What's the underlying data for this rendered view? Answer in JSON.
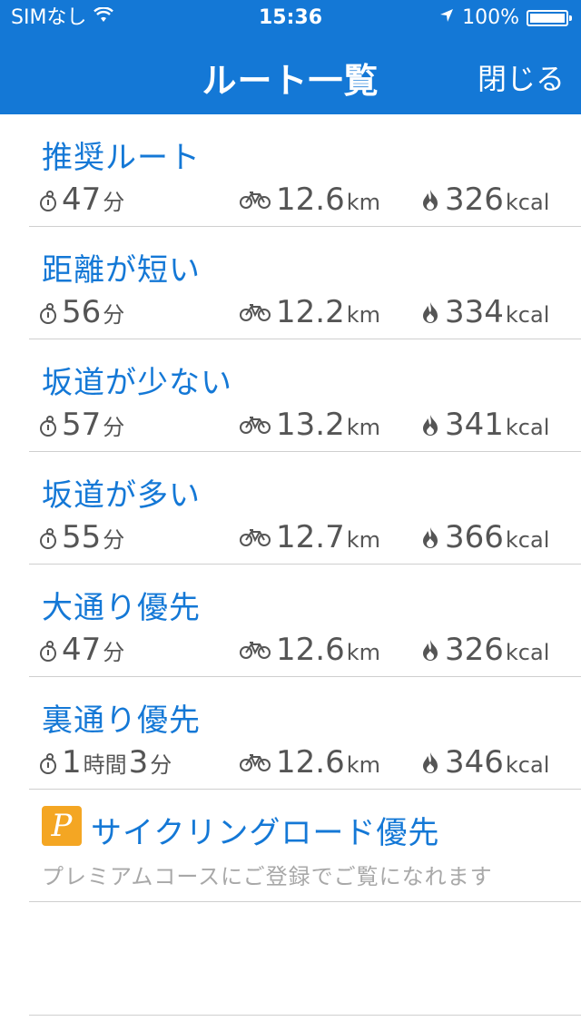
{
  "status": {
    "carrier": "SIMなし",
    "time": "15:36",
    "battery": "100%"
  },
  "nav": {
    "title": "ルート一覧",
    "close": "閉じる"
  },
  "routes": [
    {
      "name": "推奨ルート",
      "time_value": "47",
      "time_unit": "分",
      "distance_value": "12.6",
      "distance_unit": "km",
      "calorie_value": "326",
      "calorie_unit": "kcal"
    },
    {
      "name": "距離が短い",
      "time_value": "56",
      "time_unit": "分",
      "distance_value": "12.2",
      "distance_unit": "km",
      "calorie_value": "334",
      "calorie_unit": "kcal"
    },
    {
      "name": "坂道が少ない",
      "time_value": "57",
      "time_unit": "分",
      "distance_value": "13.2",
      "distance_unit": "km",
      "calorie_value": "341",
      "calorie_unit": "kcal"
    },
    {
      "name": "坂道が多い",
      "time_value": "55",
      "time_unit": "分",
      "distance_value": "12.7",
      "distance_unit": "km",
      "calorie_value": "366",
      "calorie_unit": "kcal"
    },
    {
      "name": "大通り優先",
      "time_value": "47",
      "time_unit": "分",
      "distance_value": "12.6",
      "distance_unit": "km",
      "calorie_value": "326",
      "calorie_unit": "kcal"
    },
    {
      "name": "裏通り優先",
      "time_hours": "1",
      "time_hours_unit": "時間",
      "time_value": "3",
      "time_unit": "分",
      "distance_value": "12.6",
      "distance_unit": "km",
      "calorie_value": "346",
      "calorie_unit": "kcal"
    }
  ],
  "premium": {
    "badge": "P",
    "title": "サイクリングロード優先",
    "subtitle": "プレミアムコースにご登録でご覧になれます"
  },
  "icons": {
    "time": "stopwatch-icon",
    "distance": "bicycle-icon",
    "calorie": "flame-icon",
    "wifi": "wifi-icon",
    "location": "location-arrow-icon",
    "battery": "battery-icon"
  },
  "colors": {
    "header": "#1478d6",
    "accent": "#1478d6",
    "premium_badge": "#f4a623"
  }
}
